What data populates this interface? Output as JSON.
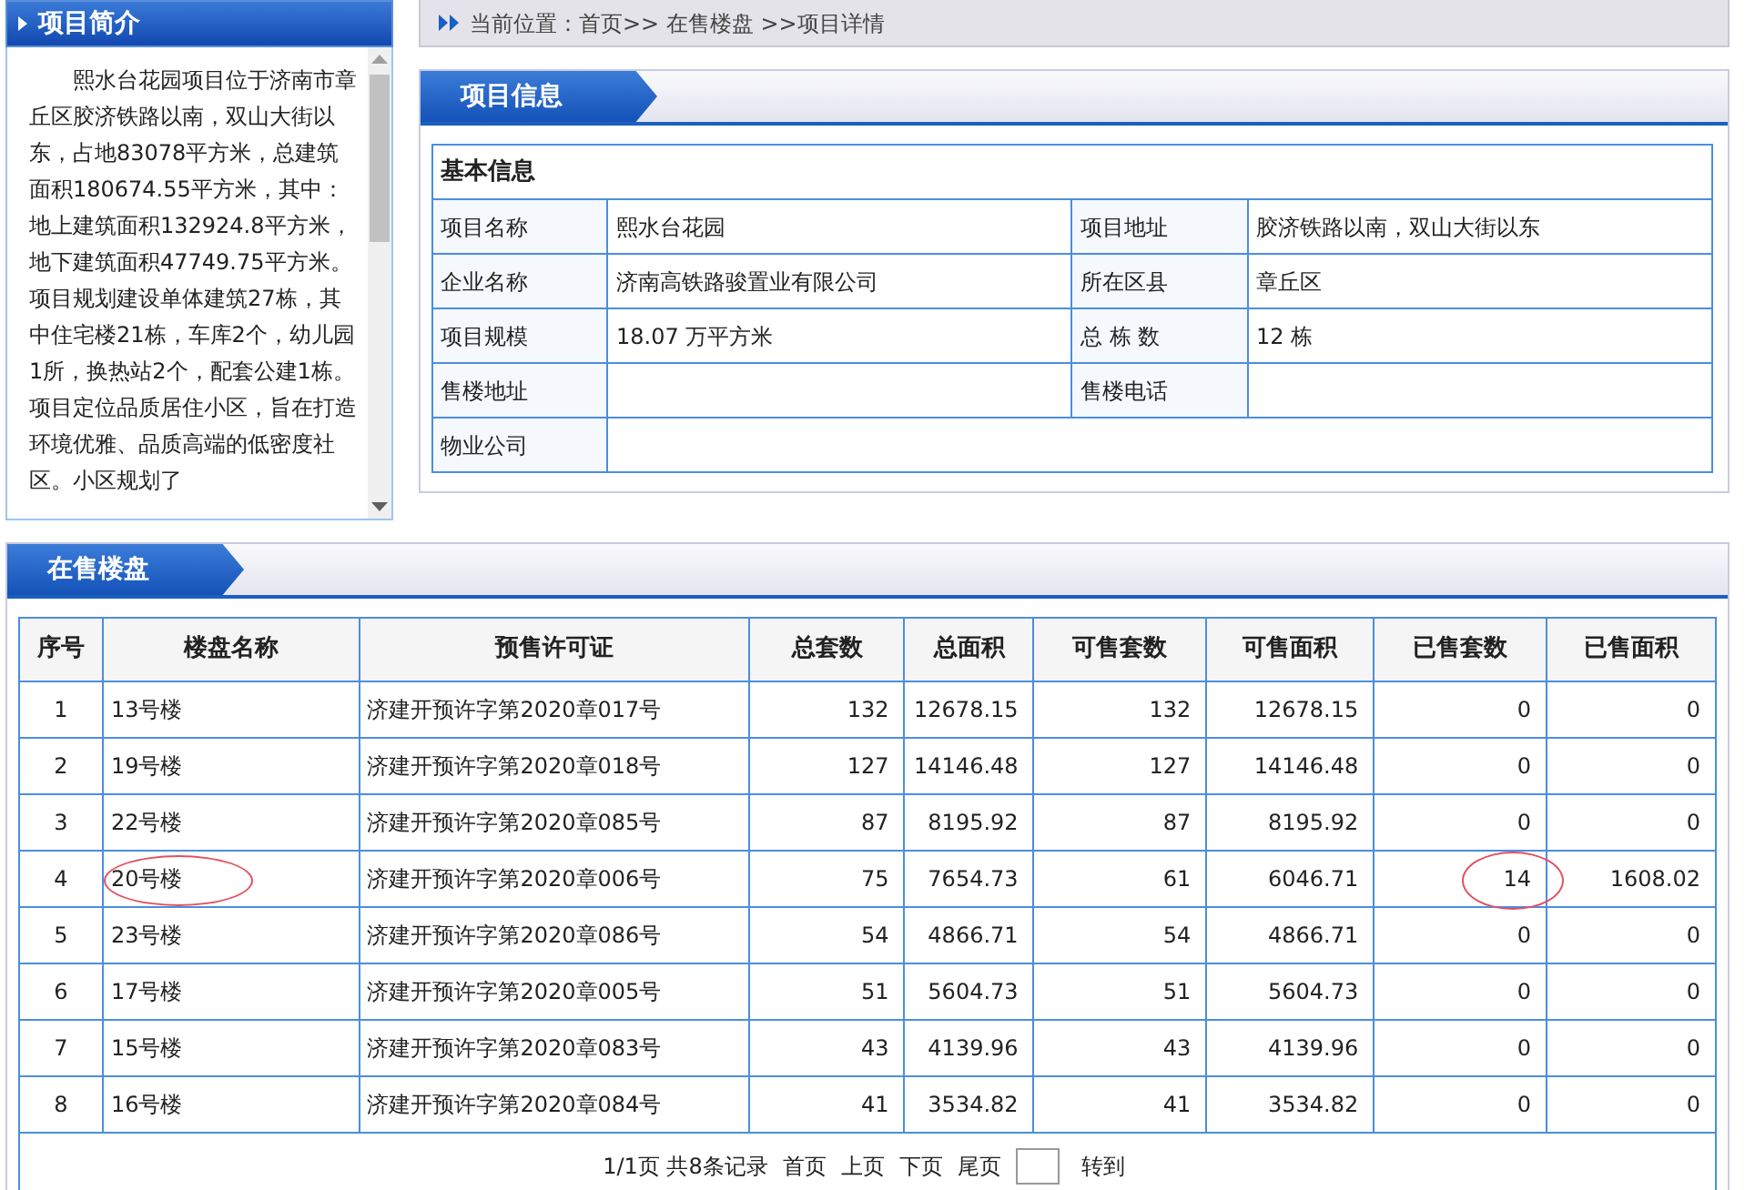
{
  "sidebar": {
    "title": "项目简介",
    "text": "熙水台花园项目位于济南市章丘区胶济铁路以南，双山大街以东，占地83078平方米，总建筑面积180674.55平方米，其中：地上建筑面积132924.8平方米，地下建筑面积47749.75平方米。项目规划建设单体建筑27栋，其中住宅楼21栋，车库2个，幼儿园1所，换热站2个，配套公建1栋。项目定位品质居住小区，旨在打造环境优雅、品质高端的低密度社区。小区规划了"
  },
  "breadcrumb": {
    "text": "当前位置：首页>> 在售楼盘 >>项目详情"
  },
  "project_info": {
    "title": "项目信息",
    "table_title": "基本信息",
    "rows": [
      [
        {
          "label": "项目名称",
          "value": "熙水台花园"
        },
        {
          "label": "项目地址",
          "value": "胶济铁路以南，双山大街以东"
        }
      ],
      [
        {
          "label": "企业名称",
          "value": "济南高铁路骏置业有限公司"
        },
        {
          "label": "所在区县",
          "value": "章丘区"
        }
      ],
      [
        {
          "label": "项目规模",
          "value": "18.07 万平方米"
        },
        {
          "label": "总 栋 数",
          "value": "12 栋"
        }
      ],
      [
        {
          "label": "售楼地址"
        },
        {
          "label": "售楼电话"
        }
      ],
      [
        {
          "label": "物业公司"
        }
      ]
    ]
  },
  "for_sale": {
    "title": "在售楼盘",
    "columns": [
      "序号",
      "楼盘名称",
      "预售许可证",
      "总套数",
      "总面积",
      "可售套数",
      "可售面积",
      "已售套数",
      "已售面积"
    ],
    "rows": [
      {
        "cells": [
          "1",
          "13号楼",
          "济建开预许字第2020章017号",
          "132",
          "12678.15",
          "132",
          "12678.15",
          "0",
          "0"
        ],
        "name_circled": false,
        "sold_circled": false
      },
      {
        "cells": [
          "2",
          "19号楼",
          "济建开预许字第2020章018号",
          "127",
          "14146.48",
          "127",
          "14146.48",
          "0",
          "0"
        ],
        "name_circled": false,
        "sold_circled": false
      },
      {
        "cells": [
          "3",
          "22号楼",
          "济建开预许字第2020章085号",
          "87",
          "8195.92",
          "87",
          "8195.92",
          "0",
          "0"
        ],
        "name_circled": false,
        "sold_circled": false
      },
      {
        "cells": [
          "4",
          "20号楼",
          "济建开预许字第2020章006号",
          "75",
          "7654.73",
          "61",
          "6046.71",
          "14",
          "1608.02"
        ],
        "name_circled": true,
        "sold_circled": true
      },
      {
        "cells": [
          "5",
          "23号楼",
          "济建开预许字第2020章086号",
          "54",
          "4866.71",
          "54",
          "4866.71",
          "0",
          "0"
        ],
        "name_circled": false,
        "sold_circled": false
      },
      {
        "cells": [
          "6",
          "17号楼",
          "济建开预许字第2020章005号",
          "51",
          "5604.73",
          "51",
          "5604.73",
          "0",
          "0"
        ],
        "name_circled": false,
        "sold_circled": false
      },
      {
        "cells": [
          "7",
          "15号楼",
          "济建开预许字第2020章083号",
          "43",
          "4139.96",
          "43",
          "4139.96",
          "0",
          "0"
        ],
        "name_circled": false,
        "sold_circled": false
      },
      {
        "cells": [
          "8",
          "16号楼",
          "济建开预许字第2020章084号",
          "41",
          "3534.82",
          "41",
          "3534.82",
          "0",
          "0"
        ],
        "name_circled": false,
        "sold_circled": false
      }
    ],
    "pager": {
      "summary": "1/1页 共8条记录",
      "links": [
        "首页",
        "上页",
        "下页",
        "尾页"
      ],
      "go": "转到"
    }
  }
}
